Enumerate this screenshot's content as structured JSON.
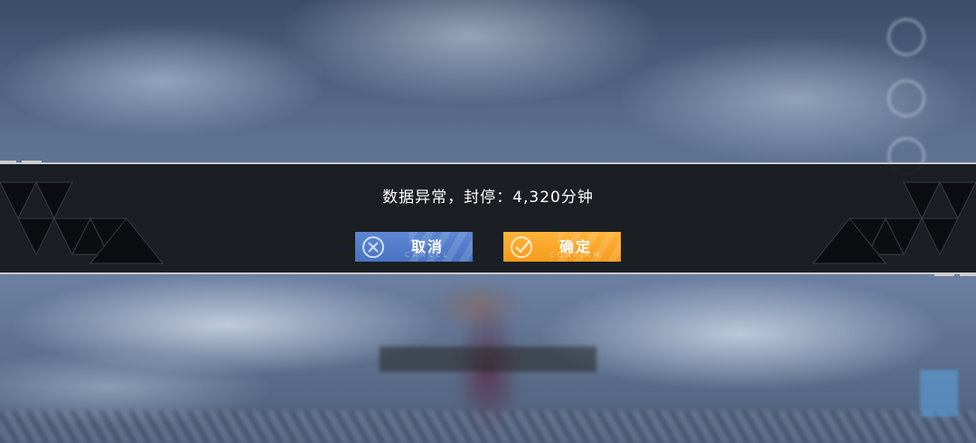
{
  "dialog": {
    "message": "数据异常，封停：4,320分钟",
    "cancel": {
      "label": "取消",
      "sub_label": "CANCEL",
      "icon": "cancel-x-circle-icon",
      "color": "#4a74c2"
    },
    "confirm": {
      "label": "确定",
      "sub_label": "CONFIRM",
      "icon": "confirm-check-circle-icon",
      "color": "#f59b1c"
    }
  }
}
